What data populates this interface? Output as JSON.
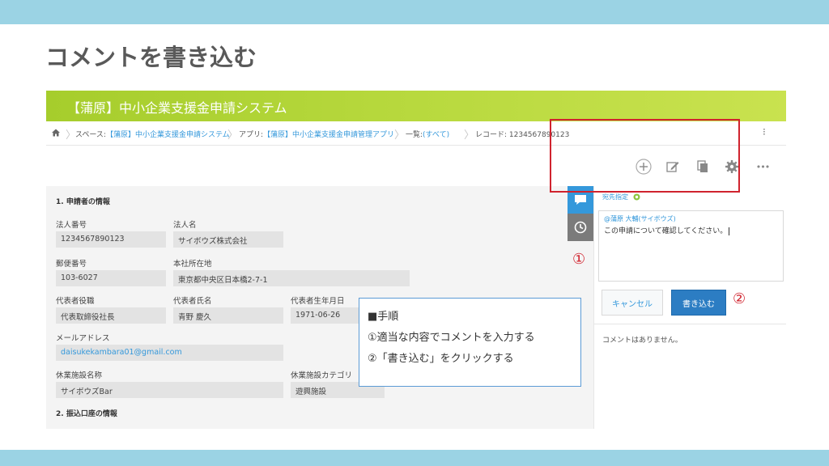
{
  "slide": {
    "title": "コメントを書き込む"
  },
  "app": {
    "title": "【蒲原】中小企業支援金申請システム"
  },
  "breadcrumb": {
    "space_prefix": "スペース:",
    "space_link": "【蒲原】中小企業支援金申請システム",
    "app_prefix": "アプリ:",
    "app_link": "【蒲原】中小企業支援金申請管理アプリ",
    "list_prefix": "一覧:",
    "list_link": "(すべて)",
    "record": "レコード: 1234567890123",
    "more": "⁝"
  },
  "toolbar": {
    "add": "+",
    "edit": "✎",
    "duplicate": "⧉",
    "settings": "⚙",
    "more": "•••"
  },
  "form": {
    "section1": "1. 申請者の情報",
    "section2": "2. 振込口座の情報",
    "fields": {
      "corp_no_label": "法人番号",
      "corp_no": "1234567890123",
      "corp_name_label": "法人名",
      "corp_name": "サイボウズ株式会社",
      "zip_label": "郵便番号",
      "zip": "103-6027",
      "address_label": "本社所在地",
      "address": "東京都中央区日本橋2-7-1",
      "rep_title_label": "代表者役職",
      "rep_title": "代表取締役社長",
      "rep_name_label": "代表者氏名",
      "rep_name": "青野 慶久",
      "rep_birth_label": "代表者生年月日",
      "rep_birth": "1971-06-26",
      "email_label": "メールアドレス",
      "email": "daisukekambara01@gmail.com",
      "facility_label": "休業施設名称",
      "facility": "サイボウズBar",
      "category_label": "休業施設カテゴリ",
      "category": "遊興施設"
    }
  },
  "comments": {
    "mention_label": "宛先指定",
    "to": "@蒲原 大輔(サイボウズ)",
    "text": "この申請について確認してください。",
    "cancel": "キャンセル",
    "post": "書き込む",
    "empty": "コメントはありません。"
  },
  "callout": {
    "heading": "■手順",
    "step1": "①適当な内容でコメントを入力する",
    "step2": "②「書き込む」をクリックする"
  },
  "markers": {
    "one": "①",
    "two": "②"
  },
  "colors": {
    "accent_red": "#d0232e",
    "link_blue": "#3498db",
    "header_green": "#b8d93e",
    "band_blue": "#9bd3e4"
  }
}
